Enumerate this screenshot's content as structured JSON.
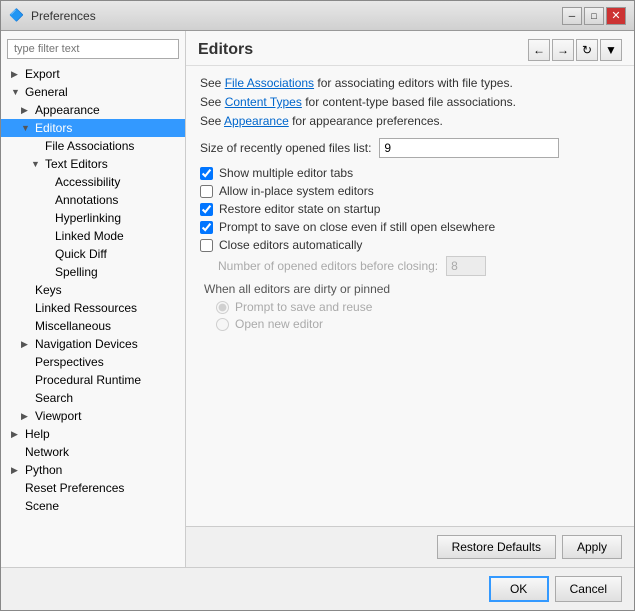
{
  "window": {
    "title": "Preferences",
    "icon": "⚙"
  },
  "title_controls": {
    "minimize": "─",
    "maximize": "□",
    "close": "✕"
  },
  "sidebar": {
    "search_placeholder": "type filter text",
    "items": [
      {
        "id": "export",
        "label": "Export",
        "indent": 1,
        "arrow": "▶",
        "selected": false
      },
      {
        "id": "general",
        "label": "General",
        "indent": 1,
        "arrow": "▼",
        "selected": false
      },
      {
        "id": "appearance",
        "label": "Appearance",
        "indent": 2,
        "arrow": "▶",
        "selected": false
      },
      {
        "id": "editors",
        "label": "Editors",
        "indent": 2,
        "arrow": "▼",
        "selected": true
      },
      {
        "id": "file-associations",
        "label": "File Associations",
        "indent": 3,
        "arrow": "",
        "selected": false
      },
      {
        "id": "text-editors",
        "label": "Text Editors",
        "indent": 3,
        "arrow": "▼",
        "selected": false
      },
      {
        "id": "accessibility",
        "label": "Accessibility",
        "indent": 4,
        "arrow": "",
        "selected": false
      },
      {
        "id": "annotations",
        "label": "Annotations",
        "indent": 4,
        "arrow": "",
        "selected": false
      },
      {
        "id": "hyperlinking",
        "label": "Hyperlinking",
        "indent": 4,
        "arrow": "",
        "selected": false
      },
      {
        "id": "linked-mode",
        "label": "Linked Mode",
        "indent": 4,
        "arrow": "",
        "selected": false
      },
      {
        "id": "quick-diff",
        "label": "Quick Diff",
        "indent": 4,
        "arrow": "",
        "selected": false
      },
      {
        "id": "spelling",
        "label": "Spelling",
        "indent": 4,
        "arrow": "",
        "selected": false
      },
      {
        "id": "keys",
        "label": "Keys",
        "indent": 2,
        "arrow": "",
        "selected": false
      },
      {
        "id": "linked-resources",
        "label": "Linked Ressources",
        "indent": 2,
        "arrow": "",
        "selected": false
      },
      {
        "id": "miscellaneous",
        "label": "Miscellaneous",
        "indent": 2,
        "arrow": "",
        "selected": false
      },
      {
        "id": "navigation-devices",
        "label": "Navigation Devices",
        "indent": 2,
        "arrow": "▶",
        "selected": false
      },
      {
        "id": "perspectives",
        "label": "Perspectives",
        "indent": 2,
        "arrow": "",
        "selected": false
      },
      {
        "id": "procedural-runtime",
        "label": "Procedural Runtime",
        "indent": 2,
        "arrow": "",
        "selected": false
      },
      {
        "id": "search",
        "label": "Search",
        "indent": 2,
        "arrow": "",
        "selected": false
      },
      {
        "id": "viewport",
        "label": "Viewport",
        "indent": 2,
        "arrow": "▶",
        "selected": false
      },
      {
        "id": "help",
        "label": "Help",
        "indent": 1,
        "arrow": "▶",
        "selected": false
      },
      {
        "id": "network",
        "label": "Network",
        "indent": 1,
        "arrow": "",
        "selected": false
      },
      {
        "id": "python",
        "label": "Python",
        "indent": 1,
        "arrow": "▶",
        "selected": false
      },
      {
        "id": "reset-preferences",
        "label": "Reset Preferences",
        "indent": 1,
        "arrow": "",
        "selected": false
      },
      {
        "id": "scene",
        "label": "Scene",
        "indent": 1,
        "arrow": "",
        "selected": false
      }
    ]
  },
  "main": {
    "title": "Editors",
    "toolbar_buttons": [
      "←",
      "→",
      "↻",
      "▼"
    ],
    "links": [
      {
        "text": "See ",
        "link_text": "File Associations",
        "suffix": " for associating editors with file types."
      },
      {
        "text": "See ",
        "link_text": "Content Types",
        "suffix": " for content-type based file associations."
      },
      {
        "text": "See ",
        "link_text": "Appearance",
        "suffix": " for appearance preferences."
      }
    ],
    "field": {
      "label": "Size of recently opened files list:",
      "value": "9"
    },
    "checkboxes": [
      {
        "id": "show-multiple-tabs",
        "label": "Show multiple editor tabs",
        "checked": true,
        "enabled": true
      },
      {
        "id": "allow-inplace",
        "label": "Allow in-place system editors",
        "checked": false,
        "enabled": true
      },
      {
        "id": "restore-state",
        "label": "Restore editor state on startup",
        "checked": true,
        "enabled": true
      },
      {
        "id": "prompt-save",
        "label": "Prompt to save on close even if still open elsewhere",
        "checked": true,
        "enabled": true
      },
      {
        "id": "close-auto",
        "label": "Close editors automatically",
        "checked": false,
        "enabled": true
      }
    ],
    "opened_editors": {
      "label": "Number of opened editors before closing:",
      "value": "8"
    },
    "dirty_group": {
      "label": "When all editors are dirty or pinned",
      "radios": [
        {
          "id": "prompt-reuse",
          "label": "Prompt to save and reuse",
          "checked": true
        },
        {
          "id": "open-new",
          "label": "Open new editor",
          "checked": false
        }
      ]
    }
  },
  "footer": {
    "restore_defaults": "Restore Defaults",
    "apply": "Apply"
  },
  "dialog_footer": {
    "ok": "OK",
    "cancel": "Cancel"
  }
}
